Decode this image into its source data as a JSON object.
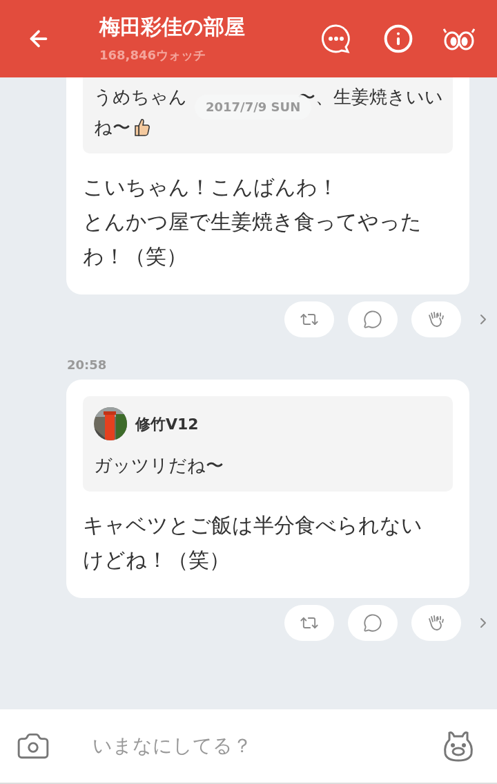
{
  "header": {
    "title": "梅田彩佳の部屋",
    "watch_count": "168,846ウォッチ"
  },
  "date_chip": "2017/7/9 SUN",
  "posts": [
    {
      "quote": {
        "lines": [
          [
            "うめちゃん",
            "〜、生姜焼きいい"
          ],
          [
            "ね〜"
          ]
        ],
        "has_emoji": true
      },
      "text": [
        "こいちゃん！こんばんわ！",
        "とんかつ屋で生姜焼き食ってやった",
        "わ！（笑）"
      ]
    },
    {
      "time": "20:58",
      "quote": {
        "author": "修竹V12",
        "lines": [
          [
            "ガッツリだね〜"
          ]
        ]
      },
      "text": [
        "キャベツとご飯は半分食べられない",
        "けどね！（笑）"
      ]
    }
  ],
  "composer": {
    "placeholder": "いまなにしてる？"
  }
}
